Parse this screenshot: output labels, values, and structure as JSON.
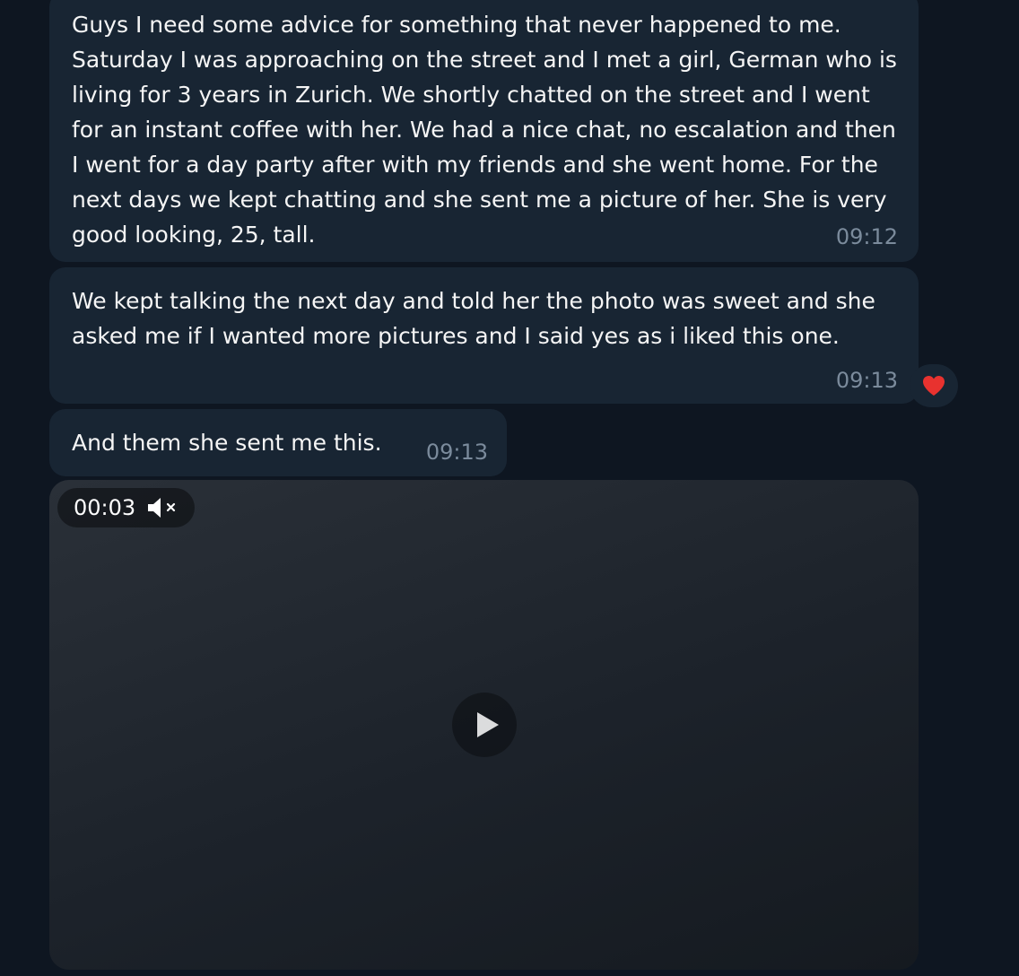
{
  "messages": [
    {
      "text": "Guys I need some advice for something that never happened to me. Saturday I was approaching on the street and I met a girl, German who is living for 3 years in Zurich. We shortly chatted on the street and I went for an instant coffee with her. We had a nice chat, no escalation and then I went for a day party after with my friends and she went home. For the next days we kept chatting and she sent me a picture of her. She is very good looking, 25, tall.",
      "time": "09:12"
    },
    {
      "text": "We kept talking the next day and told her the photo was sweet and she asked me if I wanted more pictures and I said yes as i liked this one.",
      "time": "09:13",
      "reaction_icon": "heart-icon"
    },
    {
      "text": "And them she sent me this.",
      "time": "09:13"
    }
  ],
  "video": {
    "duration": "00:03",
    "mute_icon": "speaker-muted-icon"
  },
  "colors": {
    "background": "#0e1621",
    "bubble": "#182533",
    "timestamp": "#7b8b9c",
    "reaction": "#e8322f"
  }
}
